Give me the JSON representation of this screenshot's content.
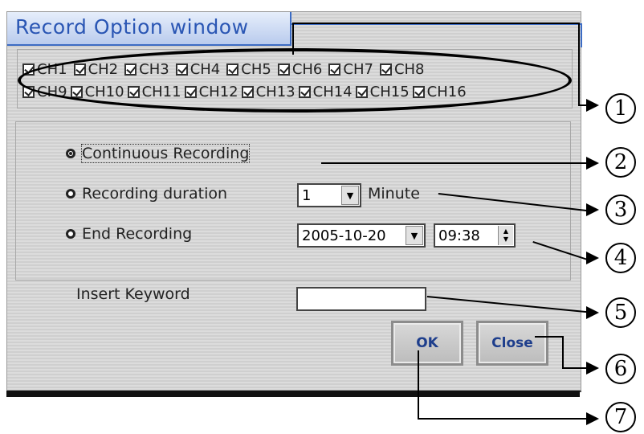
{
  "window": {
    "title": "Record Option window"
  },
  "channels": {
    "row1": [
      "CH1",
      "CH2",
      "CH3",
      "CH4",
      "CH5",
      "CH6",
      "CH7",
      "CH8"
    ],
    "row2": [
      "CH9",
      "CH10",
      "CH11",
      "CH12",
      "CH13",
      "CH14",
      "CH15",
      "CH16"
    ],
    "all_checked": true
  },
  "recording": {
    "continuous_label": "Continuous Recording",
    "duration_label": "Recording duration",
    "end_label": "End Recording",
    "duration_value": "1",
    "duration_unit": "Minute",
    "end_date": "2005-10-20",
    "end_time": "09:38",
    "selected": "continuous"
  },
  "keyword": {
    "label": "Insert Keyword",
    "value": ""
  },
  "buttons": {
    "ok": "OK",
    "close": "Close"
  },
  "callouts": [
    "1",
    "2",
    "3",
    "4",
    "5",
    "6",
    "7"
  ]
}
